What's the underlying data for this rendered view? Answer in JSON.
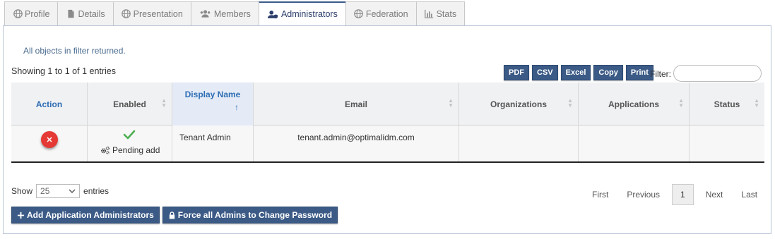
{
  "tabs": [
    {
      "label": "Profile",
      "icon": "globe-icon"
    },
    {
      "label": "Details",
      "icon": "document-icon"
    },
    {
      "label": "Presentation",
      "icon": "globe-icon"
    },
    {
      "label": "Members",
      "icon": "users-icon"
    },
    {
      "label": "Administrators",
      "icon": "user-shield-icon",
      "active": true
    },
    {
      "label": "Federation",
      "icon": "globe-icon"
    },
    {
      "label": "Stats",
      "icon": "chart-icon"
    }
  ],
  "info_message": "All objects in filter returned.",
  "showing_text": "Showing 1 to 1 of 1 entries",
  "export_buttons": [
    "PDF",
    "CSV",
    "Excel",
    "Copy",
    "Print"
  ],
  "filter": {
    "label": "Filter:",
    "value": ""
  },
  "table": {
    "headers": {
      "action": "Action",
      "enabled": "Enabled",
      "display_name": "Display Name",
      "sort_arrow": "↑",
      "email": "Email",
      "organizations": "Organizations",
      "applications": "Applications",
      "status": "Status"
    },
    "rows": [
      {
        "enabled_status": "Pending add",
        "display_name": "Tenant Admin",
        "email": "tenant.admin@optimalidm.com",
        "organizations": "",
        "applications": "",
        "status": ""
      }
    ]
  },
  "length": {
    "show_label": "Show",
    "value": "25",
    "entries_label": "entries"
  },
  "pagination": {
    "first": "First",
    "previous": "Previous",
    "current": "1",
    "next": "Next",
    "last": "Last"
  },
  "actions": {
    "add_label": "Add Application Administrators",
    "force_label": "Force all Admins to Change Password"
  },
  "colors": {
    "accent": "#3b5a86",
    "link": "#2e6db4",
    "danger": "#e53935",
    "success": "#4caf50"
  }
}
